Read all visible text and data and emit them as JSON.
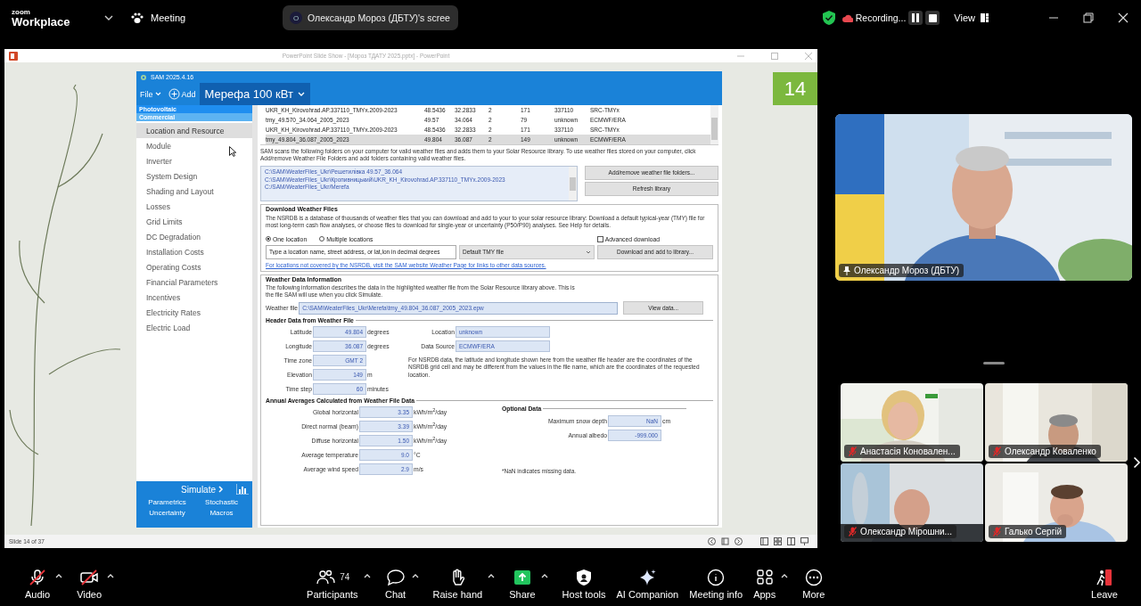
{
  "zoom_bar": {
    "logo_top": "zoom",
    "logo_bottom": "Workplace",
    "meeting": "Meeting",
    "share_pill": {
      "initial": "O",
      "label": "Олександр Мороз (ДБТУ)'s scree"
    },
    "recording": "Recording...",
    "view": "View"
  },
  "powerpoint": {
    "title": "PowerPoint Slide Show - [Мороз ТДАТУ 2025.pptx] - PowerPoint",
    "slide_badge": "14",
    "status": "Slide 14 of 37"
  },
  "sam": {
    "title": "SAM 2025.4.16",
    "file_menu": "File",
    "add_button": "Add",
    "project": "Мерефа 100 кВт",
    "technology": "Photovoltaic",
    "financial": "Commercial",
    "nav": [
      {
        "label": "Location and Resource",
        "selected": true
      },
      {
        "label": "Module",
        "selected": false
      },
      {
        "label": "Inverter",
        "selected": false
      },
      {
        "label": "System Design",
        "selected": false
      },
      {
        "label": "Shading and Layout",
        "selected": false
      },
      {
        "label": "Losses",
        "selected": false
      },
      {
        "label": "Grid Limits",
        "selected": false
      },
      {
        "label": "DC Degradation",
        "selected": false
      },
      {
        "label": "Installation Costs",
        "selected": false
      },
      {
        "label": "Operating Costs",
        "selected": false
      },
      {
        "label": "Financial Parameters",
        "selected": false
      },
      {
        "label": "Incentives",
        "selected": false
      },
      {
        "label": "Electricity Rates",
        "selected": false
      },
      {
        "label": "Electric Load",
        "selected": false
      }
    ],
    "simulate": "Simulate",
    "tools": [
      "Parametrics",
      "Stochastic",
      "Uncertainty",
      "Macros"
    ],
    "library_rows": [
      {
        "cells": [
          "UKR_KH_Kirovohrad.AP.337110_TMYx.2009-2023",
          "48.5436",
          "32.2833",
          "2",
          "171",
          "337110",
          "SRC-TMYx"
        ],
        "selected": false
      },
      {
        "cells": [
          "tmy_49.570_34.064_2005_2023",
          "49.57",
          "34.064",
          "2",
          "79",
          "unknown",
          "ECMWF/ERA"
        ],
        "selected": false
      },
      {
        "cells": [
          "UKR_KH_Kirovohrad.AP.337110_TMYx.2009-2023",
          "48.5436",
          "32.2833",
          "2",
          "171",
          "337110",
          "SRC-TMYx"
        ],
        "selected": false
      },
      {
        "cells": [
          "tmy_49.804_36.087_2005_2023",
          "49.804",
          "36.087",
          "2",
          "149",
          "unknown",
          "ECMWF/ERA"
        ],
        "selected": true
      }
    ],
    "scan_note": "SAM scans the following folders on your computer for valid weather files and adds them to your Solar Resource library. To use weather files stored on your computer, click Add/remove Weather File Folders and add folders containing valid weather files.",
    "folders": [
      "C:\\SAM\\WeaterFiles_Ukr\\Решетилівка 49.57_36.064",
      "C:\\SAM\\WeaterFiles_Ukr\\Кропивницький\\UKR_KH_Kirovohrad.AP.337110_TMYx.2009-2023",
      "C:/SAM/WeaterFiles_Ukr/Merefa"
    ],
    "folder_buttons": [
      "Add/remove weather file folders...",
      "Refresh library"
    ],
    "download": {
      "title": "Download Weather Files",
      "description": "The NSRDB is a database of thousands of weather files that you can download and add to your to your solar resource library: Download a default typical-year (TMY) file for most long-term cash flow analyses, or choose files to download for single-year or uncertainty (P50/P90) analyses. See Help for details.",
      "radios": [
        {
          "label": "One location",
          "selected": true
        },
        {
          "label": "Multiple locations",
          "selected": false
        }
      ],
      "advanced": {
        "label": "Advanced download",
        "checked": false
      },
      "location": {
        "placeholder": "Type a location name, street address, or lat,lon in decimal degrees"
      },
      "file_type": "Default TMY file",
      "button": "Download and add to library...",
      "link": "For locations not covered by the NSRDB, visit the SAM website Weather Page for links to other data sources."
    },
    "weather": {
      "title": "Weather Data Information",
      "description": "The following information describes the data in the highlighted weather file from the Solar Resource library above. This is the file SAM will use when you click Simulate.",
      "file_label": "Weather file",
      "file_value": "C:\\SAM\\WeaterFiles_Ukr\\Merefa\\tmy_49.804_36.087_2005_2023.epw",
      "view_button": "View data...",
      "header_title": "Header Data from Weather File",
      "header_fields": [
        {
          "label": "Latitude",
          "value": "49.804",
          "unit": "degrees"
        },
        {
          "label": "Longitude",
          "value": "36.087",
          "unit": "degrees"
        },
        {
          "label": "Time zone",
          "value": "GMT 2"
        },
        {
          "label": "Elevation",
          "value": "149",
          "unit": "m"
        },
        {
          "label": "Time step",
          "value": "60",
          "unit": "minutes"
        }
      ],
      "meta_fields": [
        {
          "label": "Location",
          "value": "unknown"
        },
        {
          "label": "Data Source",
          "value": "ECMWF/ERA"
        }
      ],
      "nsrdb_note": "For NSRDB data, the latitude and longitude shown here from the weather file header are the coordinates of the NSRDB grid cell and may be different from the values in the file name, which are the coordinates of the requested location.",
      "annual_title": "Annual Averages Calculated from Weather File  Data",
      "annual_fields": [
        {
          "label": "Global horizontal",
          "value": "3.35",
          "unit": "kWh/m$^{2}$/day"
        },
        {
          "label": "Direct normal (beam)",
          "value": "3.39",
          "unit": "kWh/m$^{2}$/day"
        },
        {
          "label": "Diffuse horizontal",
          "value": "1.50",
          "unit": "kWh/m$^{2}$/day"
        },
        {
          "label": "Average temperature",
          "value": "9.0",
          "unit": "°C"
        },
        {
          "label": "Average wind speed",
          "value": "2.9",
          "unit": "m/s"
        }
      ],
      "optional_title": "Optional Data",
      "optional_fields": [
        {
          "label": "Maximum snow depth",
          "value": "NaN",
          "unit": "cm"
        },
        {
          "label": "Annual albedo",
          "value": "-999.000"
        }
      ],
      "nan_note": "*NaN indicates missing data."
    }
  },
  "speaker": {
    "name": "Олександр Мороз (ДБТУ)"
  },
  "gallery": [
    {
      "name": "Анастасія Коновален...",
      "muted": true
    },
    {
      "name": "Олександр Коваленко",
      "muted": true
    },
    {
      "name": "Олександр Мірошни...",
      "muted": true
    },
    {
      "name": "Галько Сергій",
      "muted": true
    }
  ],
  "toolbar": [
    {
      "kind": "audio",
      "label": "Audio",
      "off": true,
      "caret": true
    },
    {
      "kind": "video",
      "label": "Video",
      "off": true,
      "caret": true
    },
    {
      "kind": "participants",
      "label": "Participants",
      "count": "74",
      "off": false,
      "caret": true
    },
    {
      "kind": "chat",
      "label": "Chat",
      "off": false,
      "caret": true
    },
    {
      "kind": "hand",
      "label": "Raise hand",
      "off": false,
      "caret": true
    },
    {
      "kind": "share",
      "label": "Share",
      "off": false,
      "caret": true
    },
    {
      "kind": "host",
      "label": "Host tools",
      "off": false,
      "caret": false
    },
    {
      "kind": "ai",
      "label": "AI Companion",
      "off": false,
      "caret": false
    },
    {
      "kind": "info",
      "label": "Meeting info",
      "off": false,
      "caret": false
    },
    {
      "kind": "apps",
      "label": "Apps",
      "off": false,
      "caret": true
    },
    {
      "kind": "more",
      "label": "More",
      "off": false,
      "caret": false
    }
  ],
  "leave": "Leave"
}
